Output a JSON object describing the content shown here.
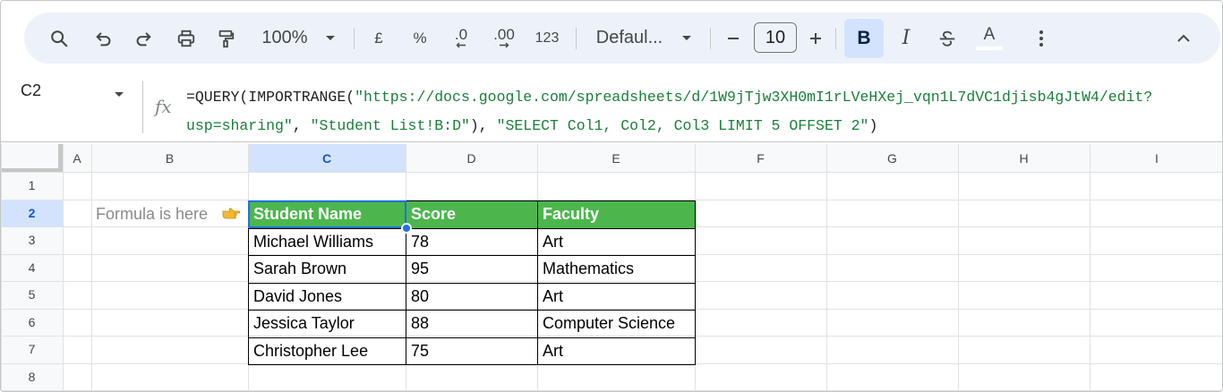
{
  "toolbar": {
    "zoom": "100%",
    "currency": "£",
    "percent": "%",
    "decrease_decimal": ".0",
    "increase_decimal": ".00",
    "number_format": "123",
    "font": "Defaul...",
    "font_size": "10",
    "bold": "B",
    "italic": "I",
    "text_color": "A"
  },
  "formula_bar": {
    "cell_ref": "C2",
    "line1_prefix": "=QUERY(IMPORTRANGE(",
    "line1_string": "\"https://docs.google.com/spreadsheets/d/1W9jTjw3XH0mI1rLVeHXej_vqn1L7dVC1djisb4gJtW4/edit?",
    "line2_string1": "usp=sharing\"",
    "line2_sep1": ", ",
    "line2_string2": "\"Student List!B:D\"",
    "line2_sep2": "), ",
    "line2_string3": "\"SELECT Col1, Col2, Col3 LIMIT 5 OFFSET 2\"",
    "line2_suffix": ")"
  },
  "grid": {
    "columns": [
      "A",
      "B",
      "C",
      "D",
      "E",
      "F",
      "G",
      "H",
      "I"
    ],
    "rows": [
      "1",
      "2",
      "3",
      "4",
      "5",
      "6",
      "7",
      "8"
    ],
    "note": "Formula is here",
    "headers": [
      "Student Name",
      "Score",
      "Faculty"
    ],
    "data": [
      [
        "Michael Williams",
        "78",
        "Art"
      ],
      [
        "Sarah Brown",
        "95",
        "Mathematics"
      ],
      [
        "David Jones",
        "80",
        "Art"
      ],
      [
        "Jessica Taylor",
        "88",
        "Computer Science"
      ],
      [
        "Christopher Lee",
        "75",
        "Art"
      ]
    ]
  },
  "colors": {
    "header_fill": "#4cb64d",
    "selection": "#1a73e8",
    "toolbar_bg": "#edf2fa",
    "formula_string": "#188038"
  }
}
